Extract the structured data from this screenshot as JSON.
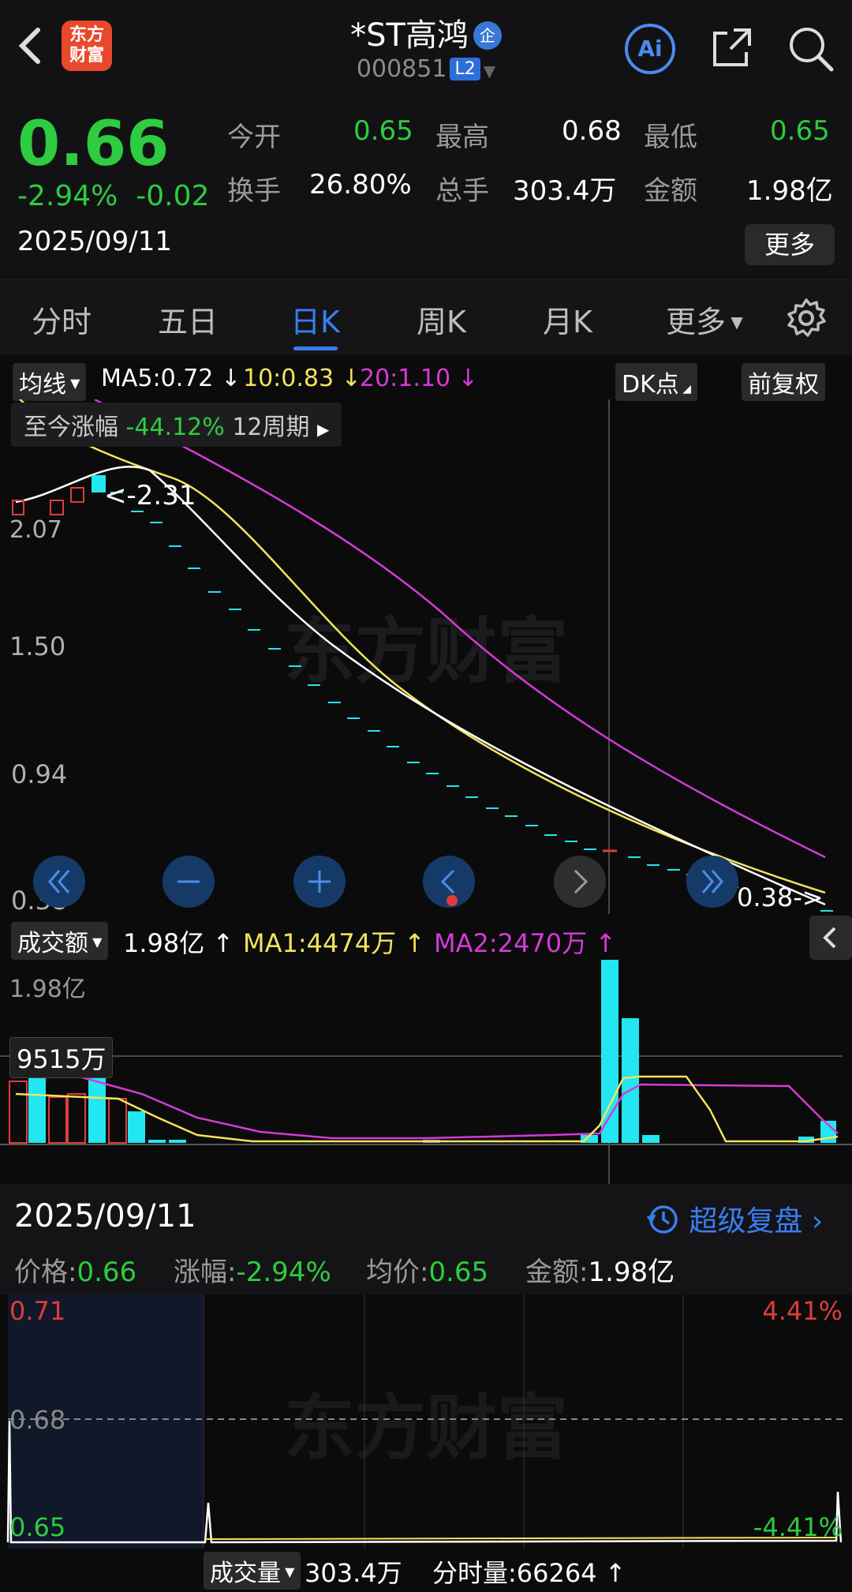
{
  "header": {
    "back_icon": "chevron-left-icon",
    "logo_text_1": "东方",
    "logo_text_2": "财富",
    "stock_name": "*ST高鸿",
    "badge": "企",
    "stock_code": "000851",
    "level": "L2",
    "ai_label": "Ai"
  },
  "quote": {
    "price": "0.66",
    "change_pct": "-2.94%",
    "change": "-0.02",
    "date": "2025/09/11",
    "open_label": "今开",
    "open": "0.65",
    "high_label": "最高",
    "high": "0.68",
    "low_label": "最低",
    "low": "0.65",
    "turnover_label": "换手",
    "turnover": "26.80%",
    "volume_label": "总手",
    "volume": "303.4万",
    "amount_label": "金额",
    "amount": "1.98亿",
    "more": "更多"
  },
  "tabs": [
    "分时",
    "五日",
    "日K",
    "周K",
    "月K",
    "更多"
  ],
  "ma_row": {
    "selector": "均线",
    "ma5": "MA5:0.72",
    "ma10": "10:0.83",
    "ma20": "20:1.10",
    "dk": "DK点",
    "adjust": "前复权"
  },
  "range_info": {
    "label": "至今涨幅",
    "value": "-44.12%",
    "period": "12周期"
  },
  "kchart": {
    "y_labels": [
      "1.50",
      "0.94",
      "0.38"
    ],
    "high_marker": "2.31",
    "left_marker": "2.07",
    "low_marker": "0.38"
  },
  "volume": {
    "selector": "成交额",
    "value": "1.98亿",
    "ma1": "MA1:4474万",
    "ma2": "MA2:2470万",
    "y_top": "1.98亿",
    "crosshair_value": "9515万"
  },
  "colors": {
    "up": "#e03c3c",
    "down": "#2ecc40",
    "ma5": "#ffffff",
    "ma10": "#f5e35a",
    "ma20": "#d63ad6",
    "bar_cyan": "#22e6f0",
    "accent": "#3a7ef0"
  },
  "detail": {
    "date": "2025/09/11",
    "replay": "超级复盘",
    "price_label": "价格:",
    "price": "0.66",
    "pct_label": "涨幅:",
    "pct": "-2.94%",
    "avg_label": "均价:",
    "avg": "0.65",
    "amount_label": "金额:",
    "amount": "1.98亿"
  },
  "mini": {
    "top_left": "0.71",
    "mid_left": "0.68",
    "bottom_left": "0.65",
    "top_right": "4.41%",
    "bottom_right": "-4.41%"
  },
  "bottom": {
    "selector": "成交量",
    "volume": "303.4万",
    "tick_label": "分时量:66264"
  },
  "watermark": "东方财富"
}
